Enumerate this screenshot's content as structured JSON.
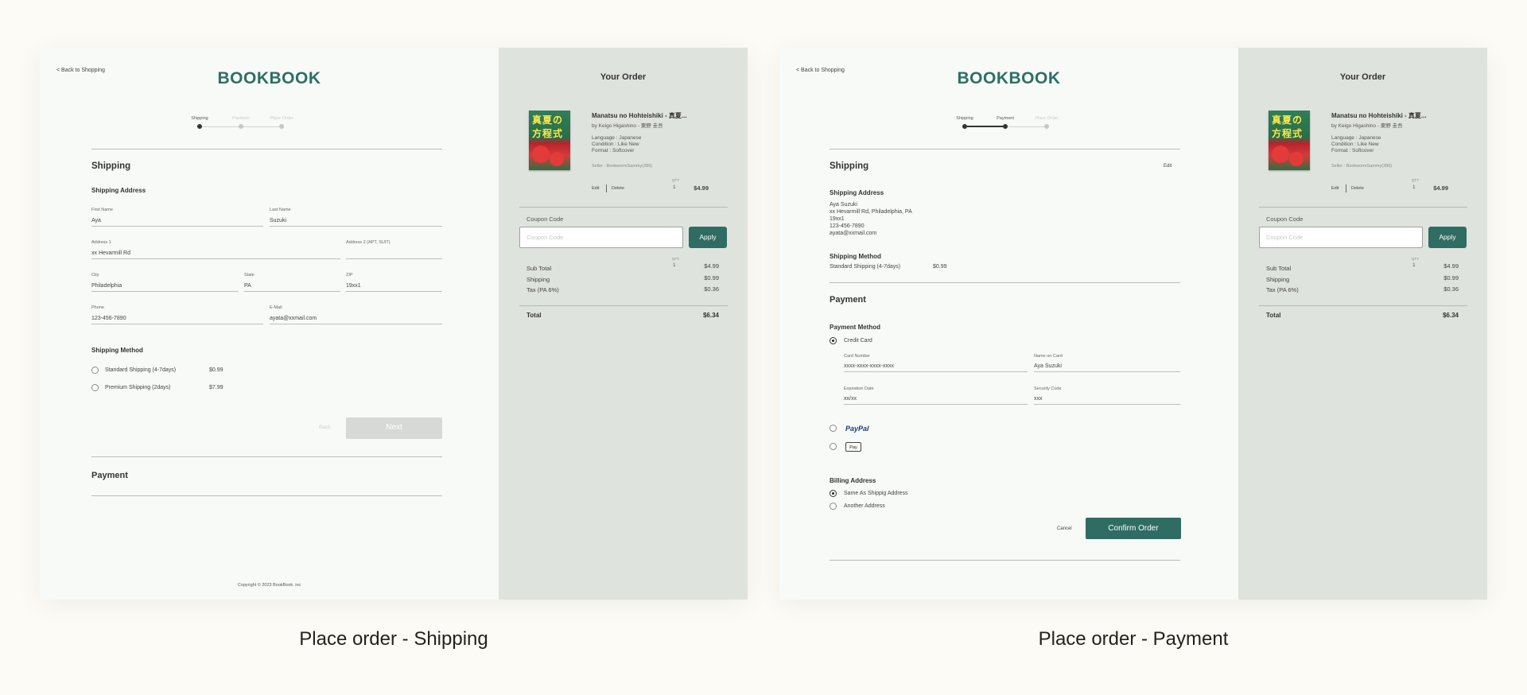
{
  "common": {
    "back_link": "< Back to Shopping",
    "logo": "BOOKBOOK",
    "steps": [
      "Shipping",
      "Payment",
      "Place Order"
    ]
  },
  "shipping_screen": {
    "shipping_heading": "Shipping",
    "address_heading": "Shipping Address",
    "fields": {
      "first_name": {
        "label": "First Name",
        "value": "Aya"
      },
      "last_name": {
        "label": "Last Name",
        "value": "Suzuki"
      },
      "address1": {
        "label": "Address 1",
        "value": "xx Hevarmill Rd"
      },
      "address2": {
        "label": "Address 2 (APT, SUIT)",
        "value": ""
      },
      "city": {
        "label": "City",
        "value": "Philadelphia"
      },
      "state": {
        "label": "State",
        "value": "PA"
      },
      "zip": {
        "label": "ZIP",
        "value": "19xx1"
      },
      "phone": {
        "label": "Phone",
        "value": "123-456-7890"
      },
      "email": {
        "label": "E-Mail",
        "value": "ayata@xxmail.com"
      }
    },
    "method_heading": "Shipping Method",
    "methods": [
      {
        "label": "Standard Shipping (4-7days)",
        "price": "$0.99"
      },
      {
        "label": "Premium Shipping (2days)",
        "price": "$7.99"
      }
    ],
    "back_label": "Back",
    "next_label": "Next",
    "payment_heading": "Payment",
    "copyright": "Copyright © 2023 BookBook. inc"
  },
  "payment_screen": {
    "shipping_heading": "Shipping",
    "edit_label": "Edit",
    "address_heading": "Shipping Address",
    "address_lines": [
      "Aya Suzuki",
      "xx Hevarmill Rd, Philadelphia, PA",
      "19xx1",
      "123-456-7890",
      "ayata@xxmail.com"
    ],
    "method_heading": "Shipping Method",
    "method_label": "Standard Shipping (4-7days)",
    "method_price": "$0.99",
    "payment_heading": "Payment",
    "payment_method_heading": "Payment Method",
    "credit_card_label": "Credit Card",
    "card_fields": {
      "card_number": {
        "label": "Card Number",
        "value": "xxxx-xxxx-xxxx-xxxx"
      },
      "name_on_card": {
        "label": "Name on Card",
        "value": "Aya Suzuki"
      },
      "expiration": {
        "label": "Expiration Date",
        "value": "xx/xx"
      },
      "security": {
        "label": "Security Code",
        "value": "xxx"
      }
    },
    "paypal_label": "PayPal",
    "applepay_label": "Pay",
    "billing_heading": "Billing Address",
    "billing_options": [
      "Same As Shippig Address",
      "Another Address"
    ],
    "cancel_label": "Cancel",
    "confirm_label": "Confirm Order"
  },
  "order": {
    "title": "Your Order",
    "book_title": "Manatsu no Hohteishiki - 真夏...",
    "author": "by Keigo Higashino - 東野 圭吾",
    "language": "Language : Japanese",
    "condition": "Condition : Like New",
    "format": "Format : Softcover",
    "seller": "Seller : BookwormSammy(286)",
    "edit": "Edit",
    "delete": "Delete",
    "qty_label": "QTY",
    "qty": "1",
    "item_price": "$4.99",
    "coupon_label": "Coupon Code",
    "coupon_placeholder": "Coupon Code",
    "apply": "Apply",
    "subtotal_label": "Sub Total",
    "subtotal": "$4.99",
    "shipping_label": "Shipping",
    "shipping": "$0.99",
    "tax_label": "Tax (PA 6%)",
    "tax": "$0.36",
    "total_label": "Total",
    "total": "$6.34",
    "cover_text": "真夏の方程式"
  },
  "captions": [
    "Place order - Shipping",
    "Place order - Payment"
  ]
}
